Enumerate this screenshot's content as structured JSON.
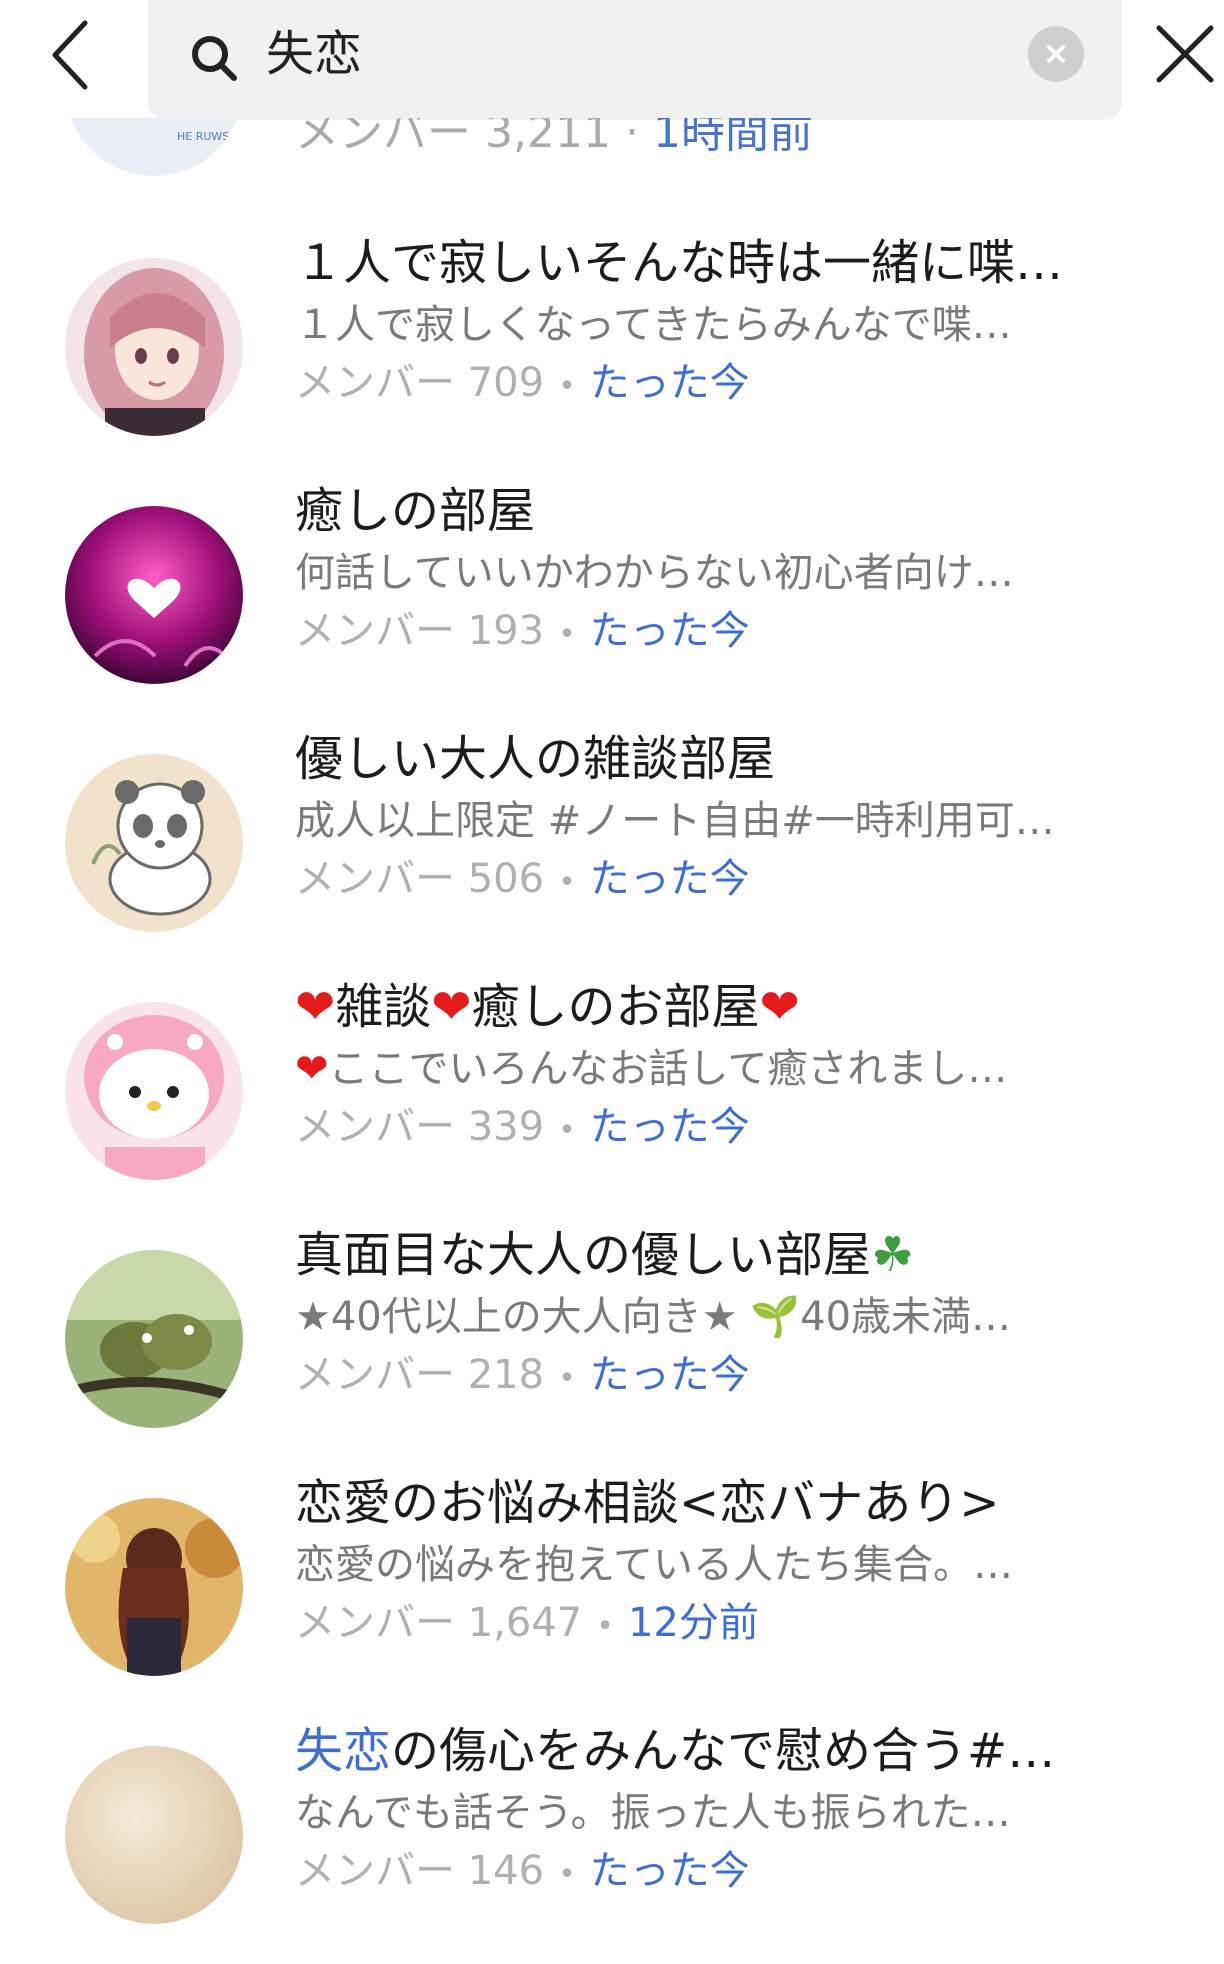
{
  "search": {
    "query": "失恋"
  },
  "partial_row": {
    "avatar_text": "HE RUWS",
    "members_label": "メンバー",
    "members_count": "3,211",
    "time": "1時間前"
  },
  "rooms": [
    {
      "title_prefix": "",
      "title": "１人で寂しいそんな時は一緒に喋…",
      "desc": "１人で寂しくなってきたらみんなで喋…",
      "members_label": "メンバー",
      "members_count": "709",
      "time": "たった今",
      "avatar": "anime-girl"
    },
    {
      "title_prefix": "",
      "title": "癒しの部屋",
      "desc": "何話していいかわからない初心者向け…",
      "members_label": "メンバー",
      "members_count": "193",
      "time": "たった今",
      "avatar": "pink-heart"
    },
    {
      "title_prefix": "",
      "title": "優しい大人の雑談部屋",
      "desc": "成人以上限定 #ノート自由#一時利用可…",
      "members_label": "メンバー",
      "members_count": "506",
      "time": "たった今",
      "avatar": "panda"
    },
    {
      "title_prefix": "",
      "title": "❤雑談❤癒しのお部屋❤",
      "desc": "❤ここでいろんなお話して癒されまし…",
      "members_label": "メンバー",
      "members_count": "339",
      "time": "たった今",
      "avatar": "my-melody"
    },
    {
      "title_prefix": "",
      "title": "真面目な大人の優しい部屋☘",
      "desc": "★40代以上の大人向き★ 🌱40歳未満…",
      "members_label": "メンバー",
      "members_count": "218",
      "time": "たった今",
      "avatar": "birds"
    },
    {
      "title_prefix": "",
      "title": "恋愛のお悩み相談<恋バナあり>",
      "desc": "恋愛の悩みを抱えている人たち集合。…",
      "members_label": "メンバー",
      "members_count": "1,647",
      "time": "12分前",
      "avatar": "woman-back"
    },
    {
      "title_prefix": "失恋",
      "title": "の傷心をみんなで慰め合う#…",
      "desc": "なんでも話そう。振った人も振られた…",
      "members_label": "メンバー",
      "members_count": "146",
      "time": "たった今",
      "avatar": "beige"
    }
  ],
  "colors": {
    "accent": "#3f6fce",
    "secondary_text": "#7a7a7a",
    "meta_text": "#b0b0b0",
    "search_bg": "#f1f1f1"
  }
}
